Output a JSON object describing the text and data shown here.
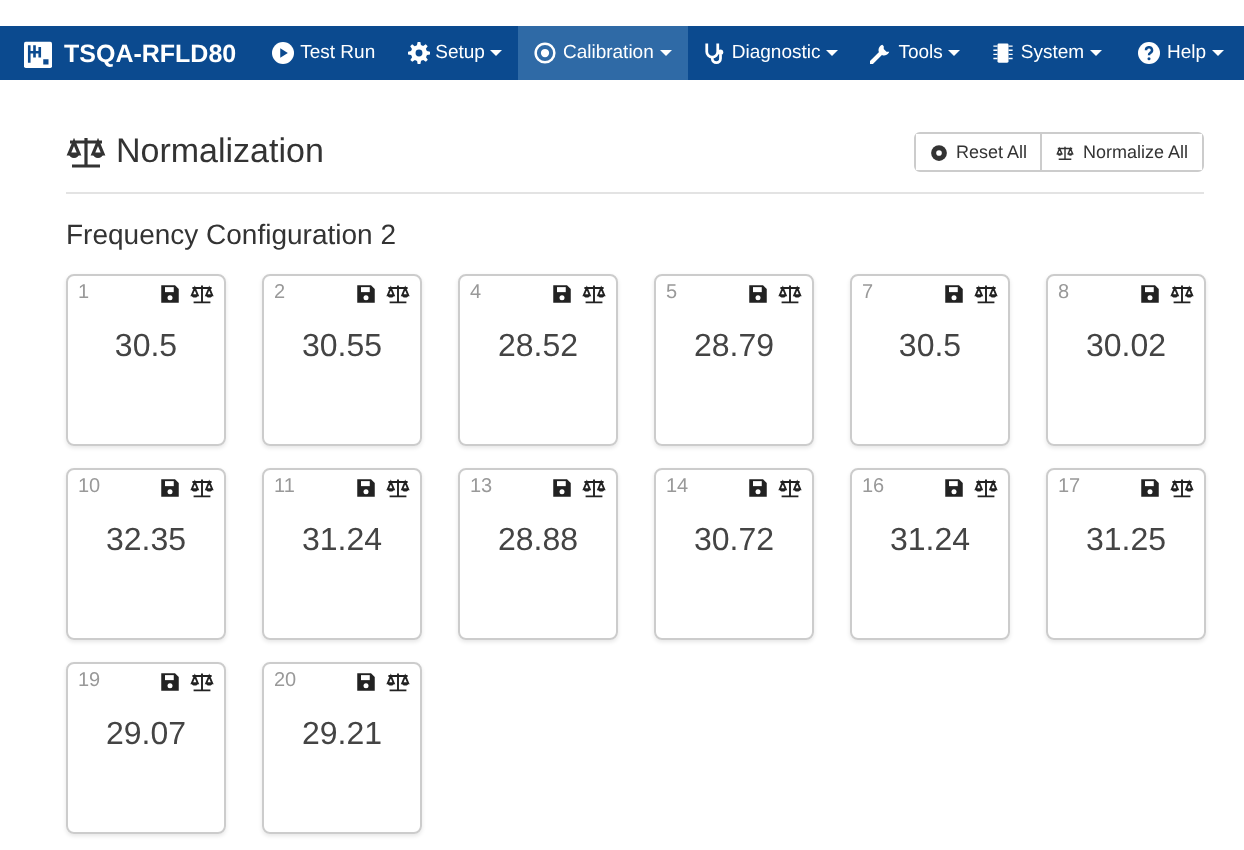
{
  "navbar": {
    "brand": "TSQA-RFLD80",
    "items": [
      {
        "label": "Test Run",
        "dropdown": false,
        "selected": false
      },
      {
        "label": "Setup",
        "dropdown": true,
        "selected": false
      },
      {
        "label": "Calibration",
        "dropdown": true,
        "selected": true
      },
      {
        "label": "Diagnostic",
        "dropdown": true,
        "selected": false
      },
      {
        "label": "Tools",
        "dropdown": true,
        "selected": false
      },
      {
        "label": "System",
        "dropdown": true,
        "selected": false
      }
    ],
    "help": {
      "label": "Help",
      "dropdown": true
    }
  },
  "page": {
    "title": "Normalization",
    "buttons": [
      {
        "label": "Reset All"
      },
      {
        "label": "Normalize All"
      }
    ],
    "section": "Frequency Configuration 2",
    "cards": [
      {
        "index": "1",
        "value": "30.5"
      },
      {
        "index": "2",
        "value": "30.55"
      },
      {
        "index": "4",
        "value": "28.52"
      },
      {
        "index": "5",
        "value": "28.79"
      },
      {
        "index": "7",
        "value": "30.5"
      },
      {
        "index": "8",
        "value": "30.02"
      },
      {
        "index": "10",
        "value": "32.35"
      },
      {
        "index": "11",
        "value": "31.24"
      },
      {
        "index": "13",
        "value": "28.88"
      },
      {
        "index": "14",
        "value": "30.72"
      },
      {
        "index": "16",
        "value": "31.24"
      },
      {
        "index": "17",
        "value": "31.25"
      },
      {
        "index": "19",
        "value": "29.07"
      },
      {
        "index": "20",
        "value": "29.21"
      }
    ]
  }
}
